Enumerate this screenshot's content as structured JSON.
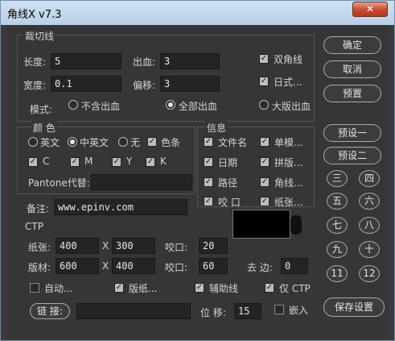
{
  "window": {
    "title": "角线X v7.3",
    "close_glyph": "✕"
  },
  "crop": {
    "group_title": "裁切线",
    "length_label": "长度:",
    "length_value": "5",
    "bleed_label": "出血:",
    "bleed_value": "3",
    "width_label": "宽度:",
    "width_value": "0.1",
    "offset_label": "偏移:",
    "offset_value": "3",
    "double_corner_label": "双角线",
    "japanese_label": "日式...",
    "mode_label": "模式:",
    "mode_options": [
      "不含出血",
      "全部出血",
      "大版出血"
    ],
    "mode_selected": "全部出血"
  },
  "color": {
    "group_title": "颜  色",
    "lang_options": [
      "英文",
      "中英文",
      "无"
    ],
    "lang_selected": "中英文",
    "color_bar_label": "色条",
    "cmyk": [
      "C",
      "M",
      "Y",
      "K"
    ],
    "pantone_label": "Pantone代替:"
  },
  "info": {
    "group_title": "信息",
    "items": [
      "文件名",
      "单模...",
      "日期",
      "拼版...",
      "路径",
      "角线...",
      "咬  口",
      "纸张..."
    ]
  },
  "note": {
    "label": "备注:",
    "value": "www.epinv.com"
  },
  "ctp": {
    "group_title": "CTP",
    "paper_label": "纸张:",
    "paper_w": "400",
    "x1": "X",
    "paper_h": "300",
    "bite1_label": "咬口:",
    "bite1_value": "20",
    "plate_label": "版材:",
    "plate_w": "600",
    "x2": "X",
    "plate_h": "400",
    "bite2_label": "咬口:",
    "bite2_value": "60",
    "remove_edge_label": "去 边:",
    "remove_edge_value": "0"
  },
  "bottom": {
    "auto_label": "自动...",
    "plate_paper_label": "版纸...",
    "aux_line_label": "辅助线",
    "ctp_only_label": "仅 CTP",
    "link_label": "链 接:",
    "shift_label": "位 移:",
    "shift_value": "15",
    "embed_label": "嵌入"
  },
  "right_buttons": {
    "confirm": "确定",
    "cancel": "取消",
    "preset": "预置",
    "preset1": "预设一",
    "preset2": "预设二",
    "numbers": [
      "三",
      "四",
      "五",
      "六",
      "七",
      "八",
      "九",
      "十",
      "11",
      "12"
    ],
    "save_settings": "保存设置"
  }
}
